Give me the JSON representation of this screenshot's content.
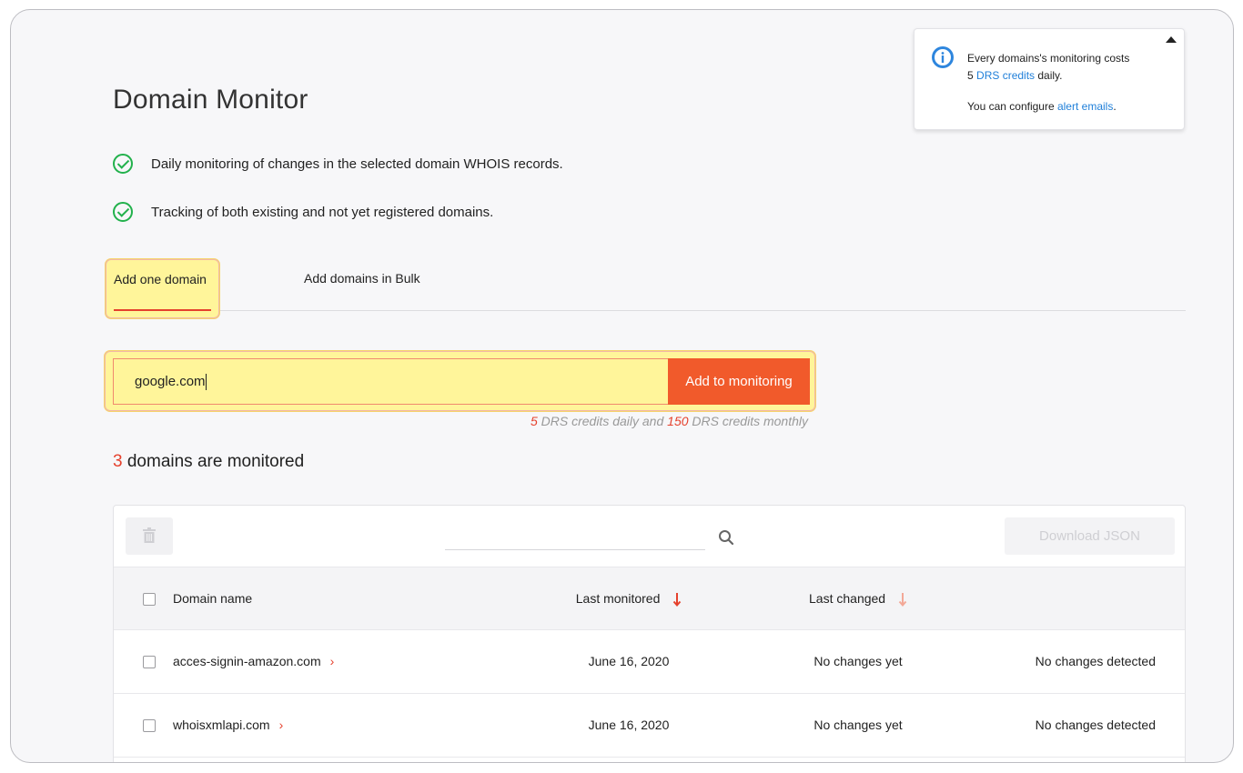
{
  "page": {
    "title": "Domain Monitor",
    "features": [
      "Daily monitoring of changes in the selected domain WHOIS records.",
      "Tracking of both existing and not yet registered domains."
    ]
  },
  "tabs": {
    "one": "Add one domain",
    "bulk": "Add domains in Bulk"
  },
  "add_form": {
    "input_value": "google.com",
    "button_label": "Add to monitoring",
    "credits_daily": "5",
    "credits_text_1": " DRS credits daily and ",
    "credits_monthly": "150",
    "credits_text_2": " DRS credits monthly"
  },
  "monitored": {
    "count": "3",
    "label": " domains are monitored"
  },
  "toolbar": {
    "download_label": "Download JSON",
    "trash_icon": "trash-icon",
    "search_icon": "search-icon"
  },
  "table": {
    "headers": {
      "name": "Domain name",
      "last_monitored": "Last monitored",
      "last_changed": "Last changed"
    },
    "rows": [
      {
        "name": "acces-signin-amazon.com",
        "last_monitored": "June 16, 2020",
        "last_changed": "No changes yet",
        "status": "No changes detected"
      },
      {
        "name": "whoisxmlapi.com",
        "last_monitored": "June 16, 2020",
        "last_changed": "No changes yet",
        "status": "No changes detected"
      }
    ]
  },
  "info": {
    "line1": "Every domains's monitoring costs",
    "line2_num": "5",
    "line2_link": "DRS credits",
    "line2_rest": " daily.",
    "line3_pre": "You can configure ",
    "line3_link": "alert emails",
    "line3_post": "."
  },
  "colors": {
    "accent": "#f15a2b",
    "red": "#e5412d",
    "highlight": "#fff59a",
    "link": "#1f7fd9",
    "check_green": "#22b14c"
  }
}
